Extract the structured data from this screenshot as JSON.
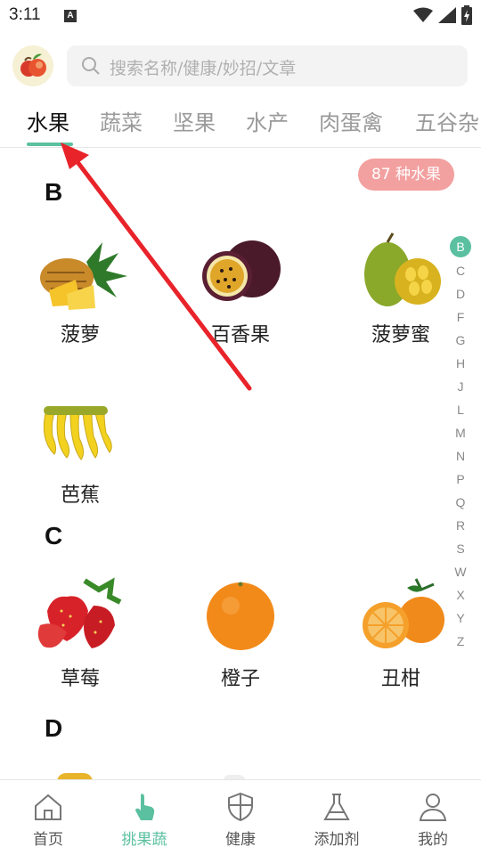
{
  "status_bar": {
    "time": "3:11",
    "notification_letter": "A"
  },
  "search": {
    "placeholder": "搜索名称/健康/妙招/文章"
  },
  "tabs": [
    {
      "label": "水果",
      "active": true
    },
    {
      "label": "蔬菜",
      "active": false
    },
    {
      "label": "坚果",
      "active": false
    },
    {
      "label": "水产",
      "active": false
    },
    {
      "label": "肉蛋禽",
      "active": false
    },
    {
      "label": "五谷杂",
      "active": false
    }
  ],
  "count_badge": "87 种水果",
  "sections": [
    {
      "letter": "B",
      "items": [
        "菠萝",
        "百香果",
        "菠萝蜜",
        "芭蕉"
      ]
    },
    {
      "letter": "C",
      "items": [
        "草莓",
        "橙子",
        "丑柑"
      ]
    },
    {
      "letter": "D",
      "items": []
    }
  ],
  "alpha_index": [
    "B",
    "C",
    "D",
    "F",
    "G",
    "H",
    "J",
    "L",
    "M",
    "N",
    "P",
    "Q",
    "R",
    "S",
    "W",
    "X",
    "Y",
    "Z"
  ],
  "alpha_active": "B",
  "bottom_nav": [
    {
      "label": "首页",
      "icon": "home-icon",
      "active": false
    },
    {
      "label": "挑果蔬",
      "icon": "hand-pointer-icon",
      "active": true
    },
    {
      "label": "健康",
      "icon": "shield-icon",
      "active": false
    },
    {
      "label": "添加剂",
      "icon": "flask-icon",
      "active": false
    },
    {
      "label": "我的",
      "icon": "user-icon",
      "active": false
    }
  ],
  "colors": {
    "accent": "#5bc0a0",
    "badge": "#f3a0a0",
    "annotation_arrow": "#e8232a"
  }
}
